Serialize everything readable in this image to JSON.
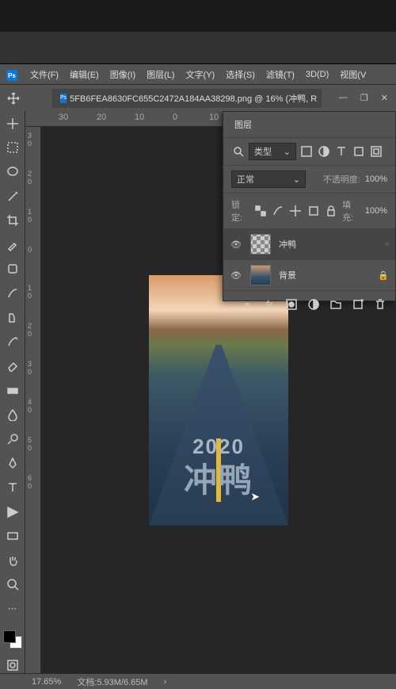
{
  "app": {
    "icon": "Ps"
  },
  "menu": {
    "file": "文件(F)",
    "edit": "编辑(E)",
    "image": "图像(I)",
    "layer": "图层(L)",
    "type": "文字(Y)",
    "select": "选择(S)",
    "filter": "滤镜(T)",
    "3d": "3D(D)",
    "view": "视图(V"
  },
  "doc": {
    "tab": "5FB6FEA8630FC655C2472A184AA38298.png @ 16% (冲鸭, R"
  },
  "ruler_h": [
    "30",
    "20",
    "10",
    "0",
    "10"
  ],
  "ruler_v": [
    "3",
    "0",
    "2",
    "0",
    "1",
    "0",
    "0",
    "1",
    "0",
    "2",
    "0",
    "3",
    "0",
    "4",
    "0",
    "5",
    "0",
    "6",
    "0"
  ],
  "artwork": {
    "text_year": "2020",
    "text_main": "冲鸭"
  },
  "layers_panel": {
    "title": "图层",
    "filter_type": "类型",
    "blend_mode": "正常",
    "opacity_label": "不透明度:",
    "opacity_value": "100%",
    "lock_label": "锁定:",
    "fill_label": "填充:",
    "fill_value": "100%",
    "items": [
      {
        "name": "冲鸭"
      },
      {
        "name": "背景"
      }
    ]
  },
  "status": {
    "zoom": "17.65%",
    "info": "文档:5.93M/6.65M"
  }
}
